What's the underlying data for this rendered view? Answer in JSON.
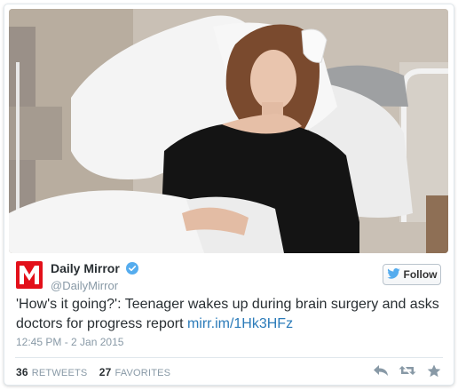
{
  "account": {
    "display_name": "Daily Mirror",
    "screen_name": "@DailyMirror",
    "logo_letter": "M",
    "verified_icon": "verified-badge-icon",
    "brand_color": "#e3101a"
  },
  "follow": {
    "label": "Follow",
    "icon": "twitter-bird-icon"
  },
  "tweet": {
    "text": "'How's it going?': Teenager wakes up during brain surgery and asks doctors for progress report ",
    "link": "mirr.im/1Hk3HFz"
  },
  "timestamp": "12:45 PM - 2 Jan 2015",
  "stats": {
    "retweets_count": "36",
    "retweets_label": "RETWEETS",
    "favorites_count": "27",
    "favorites_label": "FAVORITES"
  },
  "actions": [
    "reply-icon",
    "retweet-icon",
    "favorite-star-icon"
  ],
  "colors": {
    "link": "#2b7bb9",
    "text": "#292f33",
    "muted": "#8899a6",
    "verified": "#55acee"
  }
}
